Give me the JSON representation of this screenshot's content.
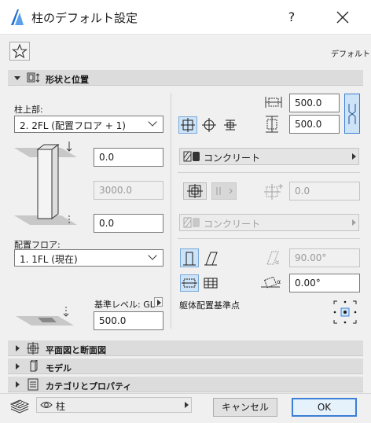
{
  "window": {
    "title": "柱のデフォルト設定",
    "help_label": "?",
    "default_label": "デフォルト"
  },
  "sections": {
    "shape_position": "形状と位置",
    "floorplan_section": "平面図と断面図",
    "model": "モデル",
    "category_properties": "カテゴリとプロパティ"
  },
  "left": {
    "top_link_label": "柱上部:",
    "top_link_value": "2. 2FL (配置フロア + 1)",
    "top_offset": "0.0",
    "height": "3000.0",
    "bottom_offset": "0.0",
    "home_story_label": "配置フロア:",
    "home_story_value": "1. 1FL (現在)",
    "reference_level_label": "基準レベル: GL",
    "reference_level_value": "500.0"
  },
  "right": {
    "width_value": "500.0",
    "depth_value": "500.0",
    "core_material": "コンクリート",
    "veneer_thickness": "0.0",
    "veneer_material": "コンクリート",
    "slant_angle": "90.00°",
    "rotation_angle": "0.00°",
    "anchor_label": "躯体配置基準点"
  },
  "footer": {
    "layer_value": "柱",
    "cancel_label": "キャンセル",
    "ok_label": "OK"
  },
  "colors": {
    "accent": "#3b7fd6",
    "selected_bg": "#cde3f7",
    "section_bg": "#dcdcdc",
    "dialog_bg": "#f0f0f0"
  },
  "icons": {
    "favorites": "star-icon",
    "close": "close-icon",
    "section_shape": "column-shape-icon",
    "section_floorplan": "floorplan-icon",
    "section_model": "model-icon",
    "section_category": "category-icon",
    "layer": "layers-icon",
    "layer_visibility": "eye-icon"
  }
}
